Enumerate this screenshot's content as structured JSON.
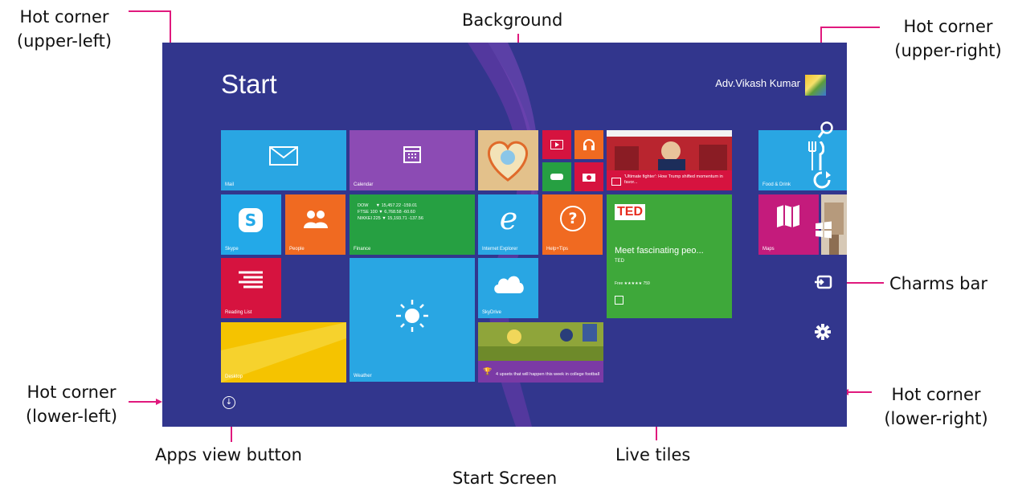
{
  "annotations": {
    "hot_upper_left": [
      "Hot corner",
      "(upper-left)"
    ],
    "background": "Background",
    "hot_upper_right": [
      "Hot corner",
      "(upper-right)"
    ],
    "charms_bar": "Charms bar",
    "hot_lower_left": [
      "Hot corner",
      "(lower-left)"
    ],
    "hot_lower_right": [
      "Hot corner",
      "(lower-right)"
    ],
    "apps_view_button": "Apps view button",
    "live_tiles": "Live tiles",
    "caption": "Start Screen"
  },
  "start_screen": {
    "title": "Start",
    "user_name": "Adv.Vikash Kumar",
    "tiles": {
      "mail": "Mail",
      "calendar": "Calendar",
      "skype": "Skype",
      "people": "People",
      "finance_text": "DOW      ▼ 15,457.22 -159.01\nFTSE 100 ▼ 6,768.58 -60.60\nNIKKEI 225 ▼ 15,193.71 -137.56",
      "finance": "Finance",
      "internet_explorer": "Internet Explorer",
      "help_tips": "Help+Tips",
      "reading_list": "Reading List",
      "skydrive": "SkyDrive",
      "desktop": "Desktop",
      "weather": "Weather",
      "news_trump": "'Ultimate fighter': How Trump shifted momentum in favor...",
      "sports_news": "4 upsets that will happen this week in college football",
      "ted_title": "Meet fascinating peo...",
      "ted_sub": "TED",
      "ted_price": "Free ★★★★★ 759",
      "food_drink": "Food & Drink",
      "maps": "Maps"
    }
  },
  "colors": {
    "screen_bg": "#32368d",
    "arrow": "#e0197d",
    "mail": "#29a6e3",
    "calendar": "#8c4bb4",
    "finance": "#26a042",
    "people": "#f06a21",
    "skype": "#23a9e8",
    "help": "#f06a21",
    "reading": "#d6133f",
    "weather": "#29a6e3",
    "ted": "#3ea83a",
    "maps": "#c41b7c"
  }
}
